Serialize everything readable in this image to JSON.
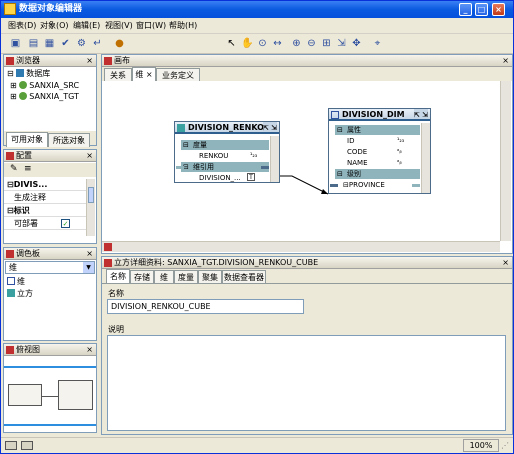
{
  "window": {
    "title": "数据对象编辑器"
  },
  "menu": [
    "图表(D)",
    "对象(O)",
    "编辑(E)",
    "视图(V)",
    "窗口(W)",
    "帮助(H)"
  ],
  "browser": {
    "title": "浏览器",
    "root": "数据库",
    "items": [
      "SANXIA_SRC",
      "SANXIA_TGT"
    ],
    "tabs": [
      "可用对象",
      "所选对象"
    ]
  },
  "config": {
    "title": "配置",
    "group1": "DIVIS...",
    "row1": "生成注释",
    "group2": "标识",
    "row2": "可部署",
    "row2_value": "✓"
  },
  "palette": {
    "title": "调色板",
    "select_value": "维",
    "items": [
      "维",
      "立方"
    ]
  },
  "overview": {
    "title": "俯视图"
  },
  "canvas": {
    "title": "画布",
    "tabs": [
      "关系",
      "维",
      "业务定义"
    ],
    "cube": {
      "title": "DIVISION_RENKO...",
      "sec_measures": "度量",
      "measure": "RENKOU",
      "sec_refs": "维引用",
      "ref": "DIVISION_..."
    },
    "dim": {
      "title": "DIVISION_DIM",
      "sec_attrs": "属性",
      "attrs": [
        "ID",
        "CODE",
        "NAME"
      ],
      "sec_levels": "级别",
      "level": "PROVINCE"
    }
  },
  "details": {
    "title": "立方详细资料: SANXIA_TGT.DIVISION_RENKOU_CUBE",
    "tabs": [
      "名称",
      "存储",
      "维",
      "度量",
      "聚集",
      "数据查看器"
    ],
    "name_label": "名称",
    "name_value": "DIVISION_RENKOU_CUBE",
    "desc_label": "说明"
  },
  "status": {
    "zoom": "100%"
  }
}
